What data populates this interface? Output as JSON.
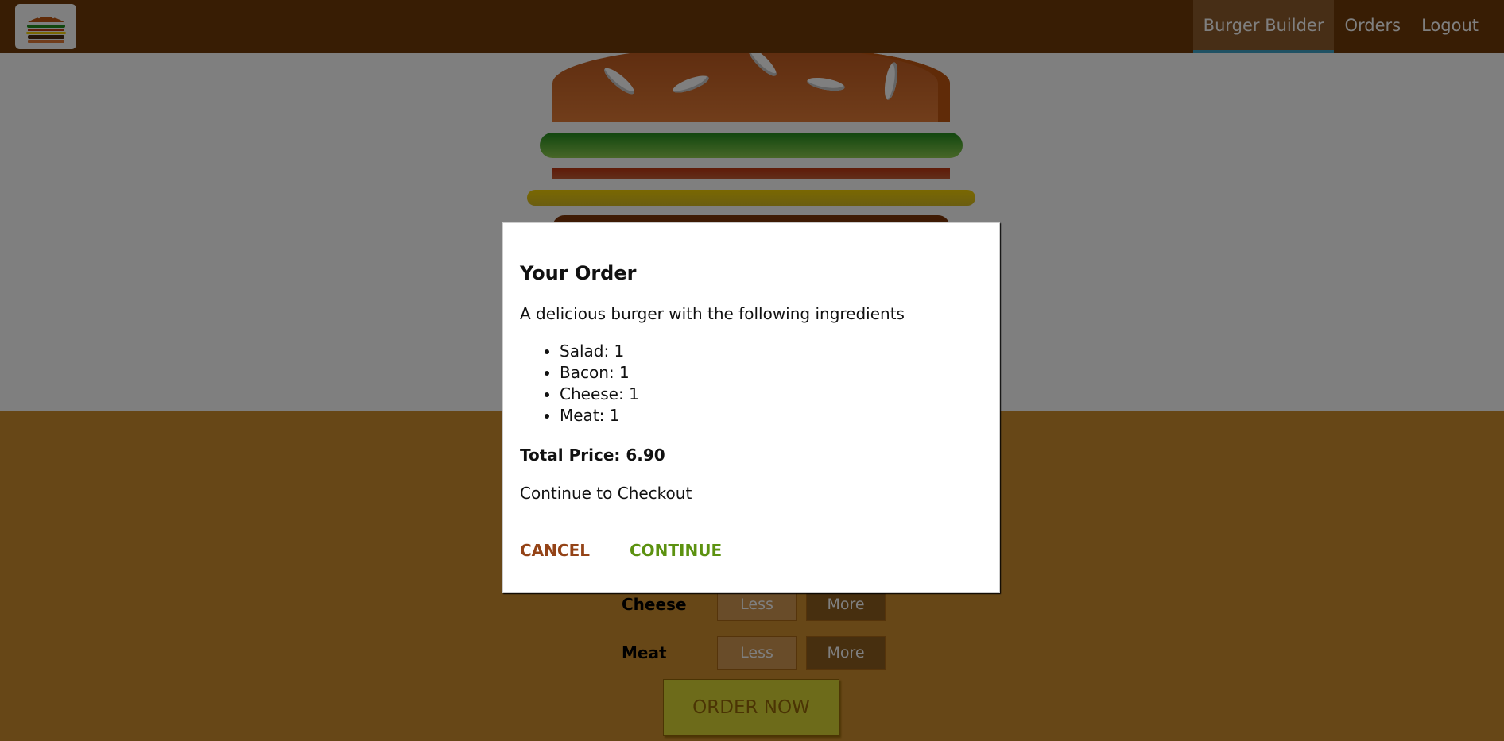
{
  "nav": {
    "items": [
      {
        "label": "Burger Builder",
        "active": true
      },
      {
        "label": "Orders",
        "active": false
      },
      {
        "label": "Logout",
        "active": false
      }
    ]
  },
  "controls": [
    {
      "label": "Cheese",
      "less": "Less",
      "more": "More"
    },
    {
      "label": "Meat",
      "less": "Less",
      "more": "More"
    }
  ],
  "order_button": "ORDER NOW",
  "modal": {
    "title": "Your Order",
    "description": "A delicious burger with the following ingredients",
    "ingredients": [
      "Salad: 1",
      "Bacon: 1",
      "Cheese: 1",
      "Meat: 1"
    ],
    "total_price": "Total Price: 6.90",
    "continue_text": "Continue to Checkout",
    "cancel_label": "CANCEL",
    "continue_label": "CONTINUE"
  },
  "colors": {
    "toolbar": "#703B09",
    "controls_bg": "#CF8F2E",
    "active_underline": "#40A4C8",
    "cancel": "#944317",
    "continue": "#5C9210"
  }
}
